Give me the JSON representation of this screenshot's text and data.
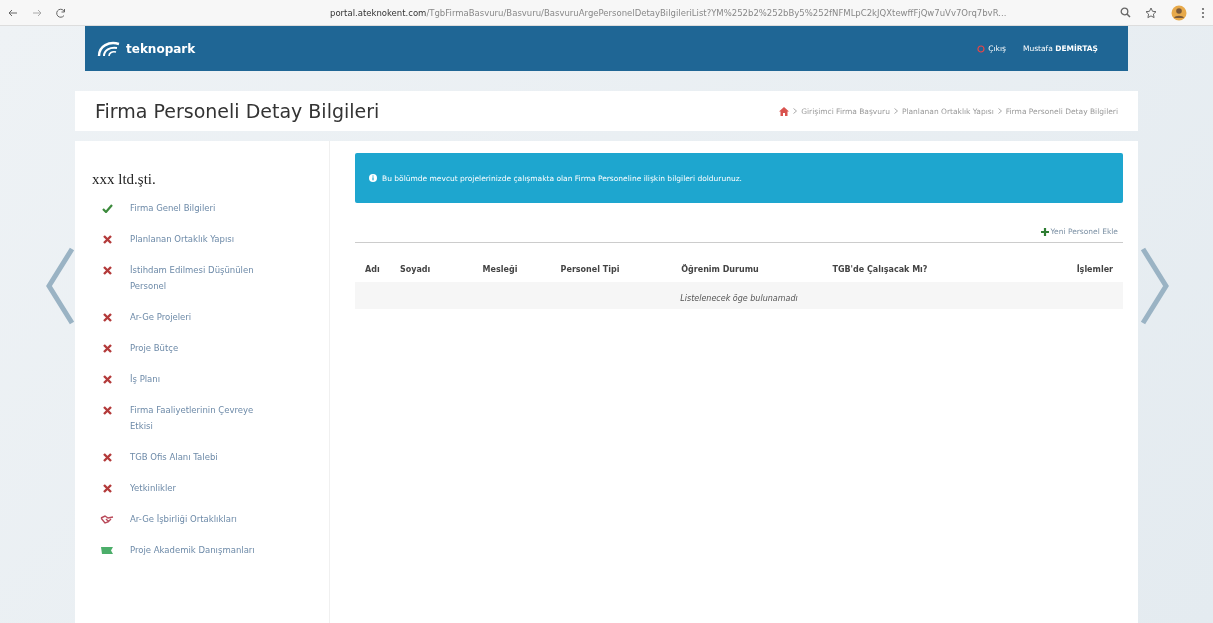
{
  "browser": {
    "url_host": "portal.ateknokent.com",
    "url_path": "/TgbFirmaBasvuru/Basvuru/BasvuruArgePersonelDetayBilgileriList?YM%252b2%252bBy5%252fNFMLpC2kJQXtewffFjQw7uVv7Orq7bvR..."
  },
  "header": {
    "brand": "teknopark",
    "logout": "Çıkış",
    "user_first": "Mustafa",
    "user_last": "DEMİRTAŞ"
  },
  "page": {
    "title": "Firma Personeli Detay Bilgileri",
    "breadcrumb": [
      "Girişimci Firma Başvuru",
      "Planlanan Ortaklık Yapısı",
      "Firma Personeli Detay Bilgileri"
    ]
  },
  "sidebar": {
    "company": "xxx ltd.şti.",
    "items": [
      {
        "label": "Firma Genel Bilgileri",
        "kind": "done"
      },
      {
        "label": "Planlanan Ortaklık Yapısı",
        "kind": "missing"
      },
      {
        "label": "İstihdam Edilmesi Düşünülen Personel",
        "kind": "missing"
      },
      {
        "label": "Ar-Ge Projeleri",
        "kind": "missing"
      },
      {
        "label": "Proje Bütçe",
        "kind": "missing"
      },
      {
        "label": "İş Planı",
        "kind": "missing"
      },
      {
        "label": "Firma Faaliyetlerinin Çevreye Etkisi",
        "kind": "missing"
      },
      {
        "label": "TGB Ofis Alanı Talebi",
        "kind": "missing"
      },
      {
        "label": "Yetkinlikler",
        "kind": "missing"
      },
      {
        "label": "Ar-Ge İşbirliği Ortaklıkları",
        "kind": "partner"
      },
      {
        "label": "Proje Akademik Danışmanları",
        "kind": "flag"
      }
    ]
  },
  "info": "Bu bölümde mevcut projelerinizde çalışmakta olan Firma Personeline ilişkin bilgileri doldurunuz.",
  "add_button": "Yeni Personel Ekle",
  "table": {
    "columns": [
      "Adı",
      "Soyadı",
      "Mesleği",
      "Personel Tipi",
      "Öğrenim Durumu",
      "TGB'de Çalışacak Mı?",
      "İşlemler"
    ],
    "empty": "Listelenecek öge bulunamadı"
  }
}
